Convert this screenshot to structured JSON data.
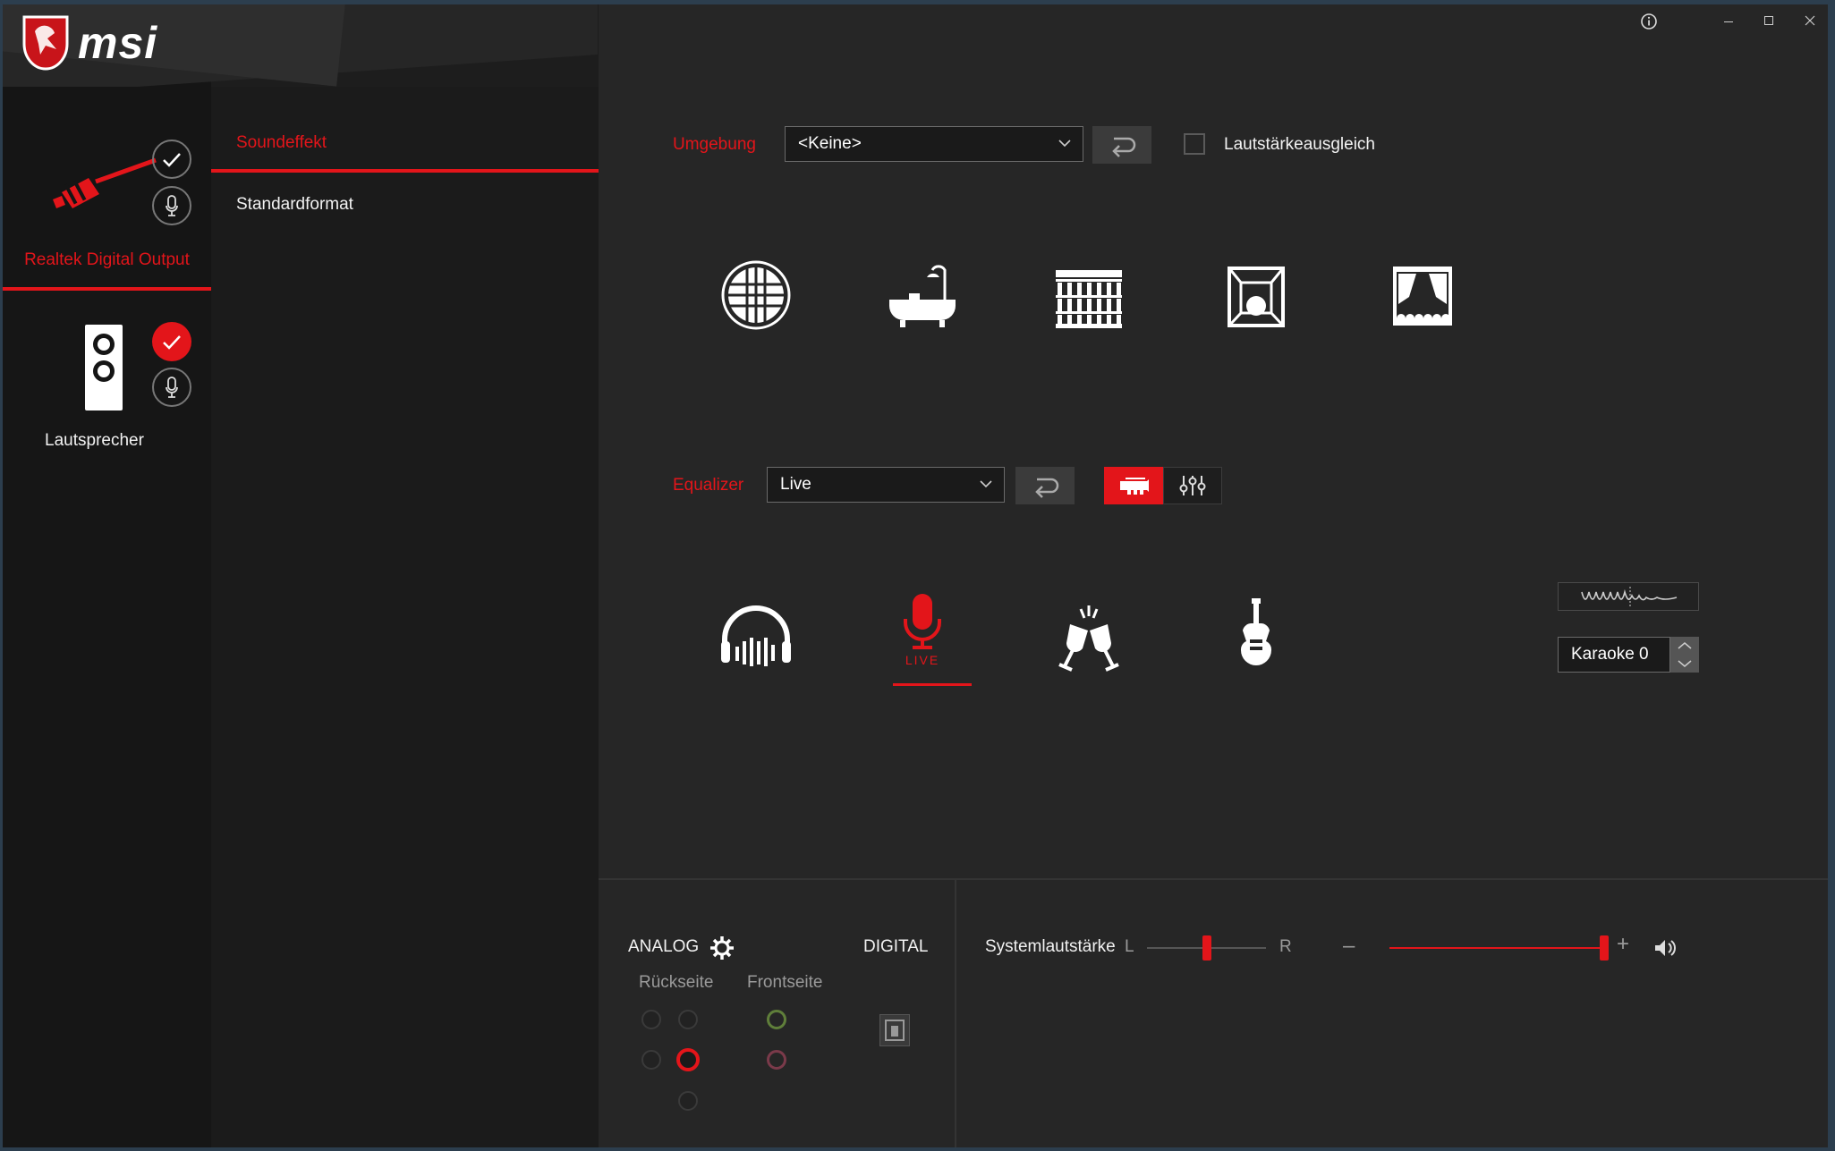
{
  "window": {
    "brand": "msi",
    "info_icon": "info-icon",
    "minimize_icon": "minimize-icon",
    "maximize_icon": "maximize-icon",
    "close_icon": "close-icon"
  },
  "devices": [
    {
      "name": "Realtek Digital Output",
      "icon": "digital-cable-icon",
      "active": true,
      "default_checked": false
    },
    {
      "name": "Lautsprecher",
      "icon": "speaker-icon",
      "active": false,
      "default_checked": true
    }
  ],
  "subnav": {
    "items": [
      {
        "label": "Soundeffekt",
        "active": true
      },
      {
        "label": "Standardformat",
        "active": false
      }
    ]
  },
  "environment": {
    "label": "Umgebung",
    "selected": "<Keine>",
    "loudness_label": "Lautstärkeausgleich",
    "loudness_checked": false,
    "icons": [
      "stone-corridor-icon",
      "bathroom-icon",
      "colosseum-icon",
      "room-icon",
      "theater-icon"
    ]
  },
  "equalizer": {
    "label": "Equalizer",
    "selected": "Live",
    "mode_buttons": [
      "trumpet-icon",
      "sliders-icon"
    ],
    "presets": [
      {
        "icon": "headphones-icon",
        "selected": false
      },
      {
        "icon": "live-mic-icon",
        "selected": true,
        "caption": "LIVE"
      },
      {
        "icon": "party-icon",
        "selected": false
      },
      {
        "icon": "guitar-icon",
        "selected": false
      }
    ],
    "karaoke_value": "Karaoke 0"
  },
  "jacks": {
    "analog_label": "ANALOG",
    "digital_label": "DIGITAL",
    "back_label": "Rückseite",
    "front_label": "Frontseite",
    "colors": {
      "back_active": "#e3151a",
      "front_green": "#5f7e3a",
      "front_pink": "#7a3a4a"
    }
  },
  "volume": {
    "label": "Systemlautstärke",
    "left": "L",
    "right": "R",
    "minus": "–",
    "plus": "+",
    "balance": 0.5,
    "level": 1.0
  },
  "colors": {
    "accent": "#e3151a"
  }
}
